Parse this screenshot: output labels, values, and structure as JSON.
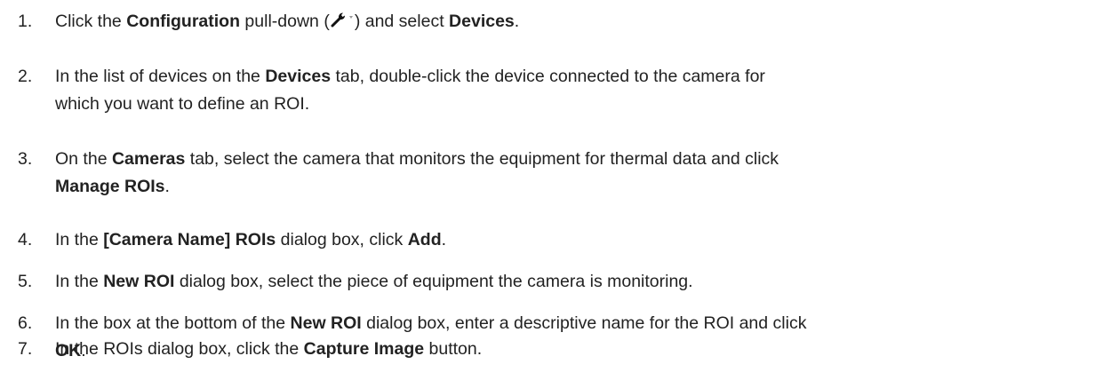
{
  "steps": [
    {
      "number": "1.",
      "lines": [
        [
          {
            "t": "Click the ",
            "b": false
          },
          {
            "t": "Configuration",
            "b": true
          },
          {
            "t": " pull-down (",
            "b": false
          },
          {
            "icon": "wrench-icon"
          },
          {
            "t": ") and select ",
            "b": false
          },
          {
            "t": "Devices",
            "b": true
          },
          {
            "t": ".",
            "b": false
          }
        ]
      ]
    },
    {
      "number": "2.",
      "lines": [
        [
          {
            "t": "In the list of devices on the ",
            "b": false
          },
          {
            "t": "Devices",
            "b": true
          },
          {
            "t": " tab, double-click the device connected to the camera for",
            "b": false
          }
        ],
        [
          {
            "t": "which you want to define an ROI.",
            "b": false
          }
        ]
      ]
    },
    {
      "number": "3.",
      "lines": [
        [
          {
            "t": "On the ",
            "b": false
          },
          {
            "t": "Cameras",
            "b": true
          },
          {
            "t": " tab, select the camera that monitors the equipment for thermal data and click",
            "b": false
          }
        ],
        [
          {
            "t": "Manage ROIs",
            "b": true
          },
          {
            "t": ".",
            "b": false
          }
        ]
      ]
    },
    {
      "number": "4.",
      "lines": [
        [
          {
            "t": "In the ",
            "b": false
          },
          {
            "t": "[Camera Name] ROIs",
            "b": true
          },
          {
            "t": " dialog box, click ",
            "b": false
          },
          {
            "t": "Add",
            "b": true
          },
          {
            "t": ".",
            "b": false
          }
        ]
      ]
    },
    {
      "number": "5.",
      "lines": [
        [
          {
            "t": "In the ",
            "b": false
          },
          {
            "t": "New ROI",
            "b": true
          },
          {
            "t": " dialog box, select the piece of equipment the camera is monitoring.",
            "b": false
          }
        ]
      ]
    },
    {
      "number": "6.",
      "lines": [
        [
          {
            "t": "In the box at the bottom of the ",
            "b": false
          },
          {
            "t": "New ROI",
            "b": true
          },
          {
            "t": " dialog box, enter a descriptive name for the ROI and click",
            "b": false
          }
        ],
        [
          {
            "t": "OK",
            "b": true
          },
          {
            "t": ".",
            "b": false
          }
        ]
      ]
    },
    {
      "number": "7.",
      "lines": [
        [
          {
            "t": "In the ROIs dialog box, click the ",
            "b": false
          },
          {
            "t": "Capture Image",
            "b": true
          },
          {
            "t": " button.",
            "b": false
          }
        ]
      ]
    }
  ]
}
